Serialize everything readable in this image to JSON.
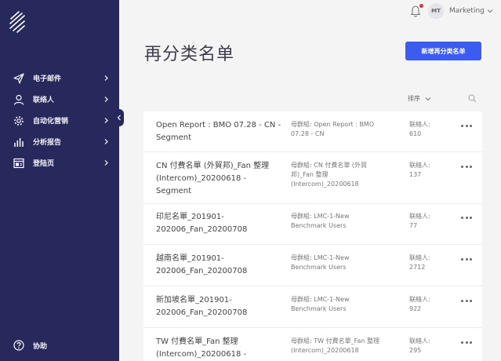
{
  "sidebar": {
    "items": [
      {
        "label": "电子邮件",
        "icon": "send-icon"
      },
      {
        "label": "联络人",
        "icon": "person-icon"
      },
      {
        "label": "自动化营销",
        "icon": "gear-icon"
      },
      {
        "label": "分析报告",
        "icon": "bar-chart-icon"
      },
      {
        "label": "登陆页",
        "icon": "landing-page-icon"
      }
    ],
    "help_label": "协助"
  },
  "topbar": {
    "avatar_initials": "MT",
    "account_name": "Marketing"
  },
  "page": {
    "title": "再分类名单",
    "create_button": "新增再分类名单",
    "sort_label": "排序"
  },
  "colors": {
    "sidebar_bg": "#27285c",
    "primary_button": "#3a5cf0",
    "notification_dot": "#e0303a"
  },
  "segments": [
    {
      "name": "Open Report : BMO 07.28 - CN - Segment",
      "parent": "母群組: Open Report : BMO 07.28 - CN",
      "count_label": "联絡人:",
      "count": "610"
    },
    {
      "name": "CN 付費名單 (外貿邦)_Fan 整理 (Intercom)_20200618 - Segment",
      "parent": "母群組: CN 付費名單 (外貿邦)_Fan 整理 (Intercom)_20200618",
      "count_label": "联絡人:",
      "count": "137"
    },
    {
      "name": "印尼名單_201901-202006_Fan_20200708",
      "parent": "母群組: LMC-1-New Benchmark Users",
      "count_label": "联絡人:",
      "count": "77"
    },
    {
      "name": "越南名單_201901-202006_Fan_20200708",
      "parent": "母群組: LMC-1-New Benchmark Users",
      "count_label": "联絡人:",
      "count": "2712"
    },
    {
      "name": "新加坡名單_201901-202006_Fan_20200708",
      "parent": "母群組: LMC-1-New Benchmark Users",
      "count_label": "联絡人:",
      "count": "922"
    },
    {
      "name": "TW 付費名單_Fan 整理 (Intercom)_20200618 -",
      "parent": "母群組: TW 付費名單_Fan 整理 (Intercom)_20200618",
      "count_label": "联絡人:",
      "count": "295"
    }
  ]
}
